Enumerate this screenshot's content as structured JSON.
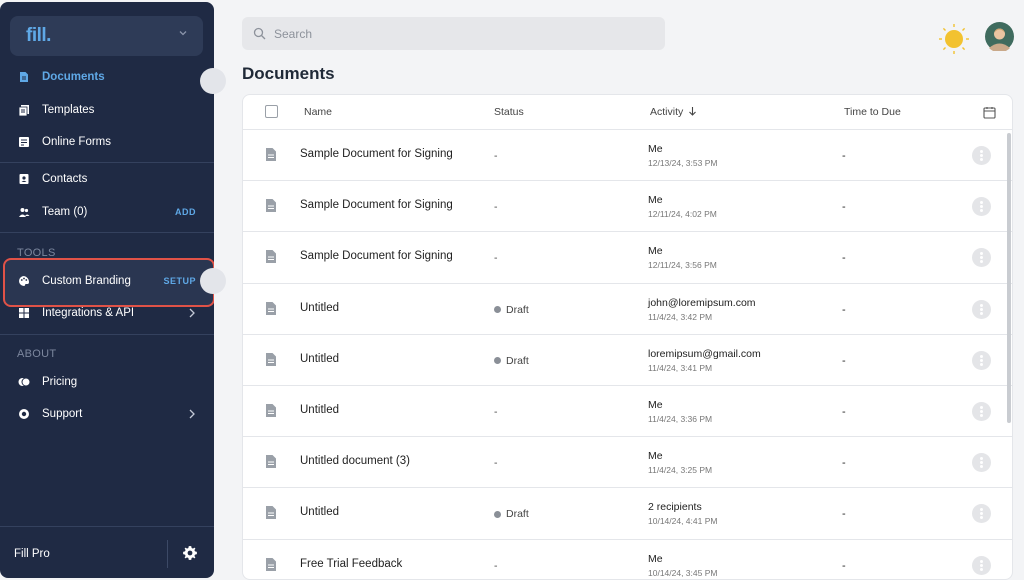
{
  "sidebar": {
    "brand": "fill.",
    "items": [
      {
        "label": "Documents",
        "icon": "document-icon"
      },
      {
        "label": "Templates",
        "icon": "templates-icon"
      },
      {
        "label": "Online Forms",
        "icon": "form-icon"
      },
      {
        "label": "Contacts",
        "icon": "contacts-icon"
      },
      {
        "label": "Team (0)",
        "icon": "team-icon",
        "action": "ADD"
      },
      {
        "label": "Custom Branding",
        "icon": "palette-icon",
        "action": "SETUP"
      },
      {
        "label": "Integrations & API",
        "icon": "integrations-icon"
      },
      {
        "label": "Pricing",
        "icon": "pricing-icon"
      },
      {
        "label": "Support",
        "icon": "support-icon"
      }
    ],
    "section_tools": "TOOLS",
    "section_about": "ABOUT",
    "footer_label": "Fill Pro"
  },
  "search": {
    "placeholder": "Search"
  },
  "page_title": "Documents",
  "table": {
    "columns": [
      "Name",
      "Status",
      "Activity",
      "Time to Due"
    ],
    "rows": [
      {
        "name": "Sample Document for Signing",
        "status": "-",
        "who": "Me",
        "time": "12/13/24, 3:53 PM",
        "due": "-"
      },
      {
        "name": "Sample Document for Signing",
        "status": "-",
        "who": "Me",
        "time": "12/11/24, 4:02 PM",
        "due": "-"
      },
      {
        "name": "Sample Document for Signing",
        "status": "-",
        "who": "Me",
        "time": "12/11/24, 3:56 PM",
        "due": "-"
      },
      {
        "name": "Untitled",
        "status": "Draft",
        "who": "john@loremipsum.com",
        "time": "11/4/24, 3:42 PM",
        "due": "-"
      },
      {
        "name": "Untitled",
        "status": "Draft",
        "who": "loremipsum@gmail.com",
        "time": "11/4/24, 3:41 PM",
        "due": "-"
      },
      {
        "name": "Untitled",
        "status": "-",
        "who": "Me",
        "time": "11/4/24, 3:36 PM",
        "due": "-"
      },
      {
        "name": "Untitled document (3)",
        "status": "-",
        "who": "Me",
        "time": "11/4/24, 3:25 PM",
        "due": "-"
      },
      {
        "name": "Untitled",
        "status": "Draft",
        "who": "2 recipients",
        "time": "10/14/24, 4:41 PM",
        "due": "-"
      },
      {
        "name": "Free Trial Feedback",
        "status": "-",
        "who": "Me",
        "time": "10/14/24, 3:45 PM",
        "due": "-"
      }
    ]
  },
  "colors": {
    "sidebar_bg": "#1f2a44",
    "accent": "#5fa8e6",
    "highlight_border": "#e05247"
  }
}
